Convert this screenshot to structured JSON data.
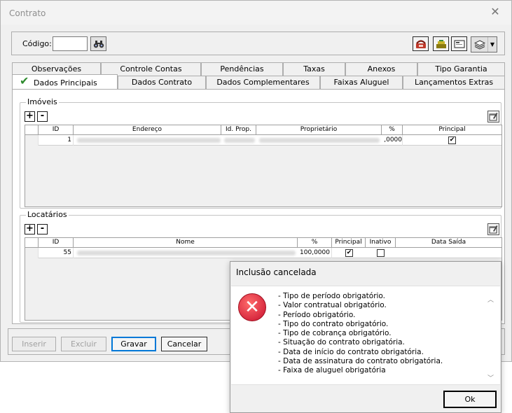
{
  "window": {
    "title": "Contrato",
    "close_glyph": "✕"
  },
  "toolbar": {
    "codigo_label": "Código:",
    "codigo_value": "",
    "icons": [
      "binoculars-icon",
      "phone-icon",
      "cash-register-icon",
      "card-icon",
      "layers-icon"
    ]
  },
  "tabs_top": [
    "Observações",
    "Controle Contas",
    "Pendências",
    "Taxas",
    "Anexos",
    "Tipo Garantia"
  ],
  "tabs_bottom": [
    "Dados Principais",
    "Dados Contrato",
    "Dados Complementares",
    "Faixas Aluguel",
    "Lançamentos Extras"
  ],
  "imoveis": {
    "legend": "Imóveis",
    "add": "+",
    "remove": "-",
    "headers": [
      "ID",
      "Endereço",
      "Id. Prop.",
      "Proprietário",
      "%",
      "Principal"
    ],
    "row": {
      "id": "1",
      "pct": ",0000",
      "principal": "✔"
    }
  },
  "locatarios": {
    "legend": "Locatários",
    "add": "+",
    "remove": "-",
    "headers": [
      "ID",
      "Nome",
      "%",
      "Principal",
      "Inativo",
      "Data Saída"
    ],
    "row": {
      "id": "55",
      "pct": "100,0000",
      "principal": "✔",
      "inativo": ""
    }
  },
  "buttons": {
    "inserir": "Inserir",
    "excluir": "Excluir",
    "gravar": "Gravar",
    "cancelar": "Cancelar"
  },
  "dialog": {
    "title": "Inclusão cancelada",
    "icon_glyph": "✕",
    "messages": [
      "- Tipo de período obrigatório.",
      "- Valor contratual obrigatório.",
      "- Período obrigatório.",
      "- Tipo do contrato obrigatório.",
      "- Tipo de cobrança obrigatório.",
      "- Situação do contrato obrigatória.",
      "- Data de início do contrato obrigatória.",
      "- Data de assinatura do contrato obrigatória.",
      "- Faixa de aluguel obrigatória"
    ],
    "ok": "Ok"
  },
  "colors": {
    "accent": "#0078d7",
    "error": "#c8102e",
    "check": "#2e8b2e"
  }
}
